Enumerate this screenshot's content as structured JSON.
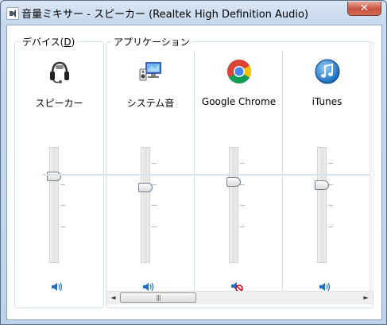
{
  "window": {
    "title": "音量ミキサー - スピーカー (Realtek High Definition Audio)",
    "close_glyph": "✕"
  },
  "device_group": {
    "label": "デバイス(D)",
    "channel": {
      "label": "スピーカー",
      "icon": "headset-icon",
      "volume_level": 0.63,
      "muted": false
    }
  },
  "apps_group": {
    "label": "アプリケーション",
    "channels": [
      {
        "label": "システム音",
        "icon": "system-sounds-icon",
        "volume_level": 0.52,
        "muted": false
      },
      {
        "label": "Google Chrome",
        "icon": "chrome-icon",
        "volume_level": 0.57,
        "muted": true
      },
      {
        "label": "iTunes",
        "icon": "itunes-icon",
        "volume_level": 0.54,
        "muted": false
      }
    ]
  },
  "scrollbar": {
    "left_arrow": "◄",
    "right_arrow": "►",
    "grip": "|||"
  },
  "colors": {
    "title_bar": "#c6d8ec",
    "close_button": "#c75240",
    "speaker_icon": "#1e6fc4",
    "mute_icon": "#d0021b"
  }
}
